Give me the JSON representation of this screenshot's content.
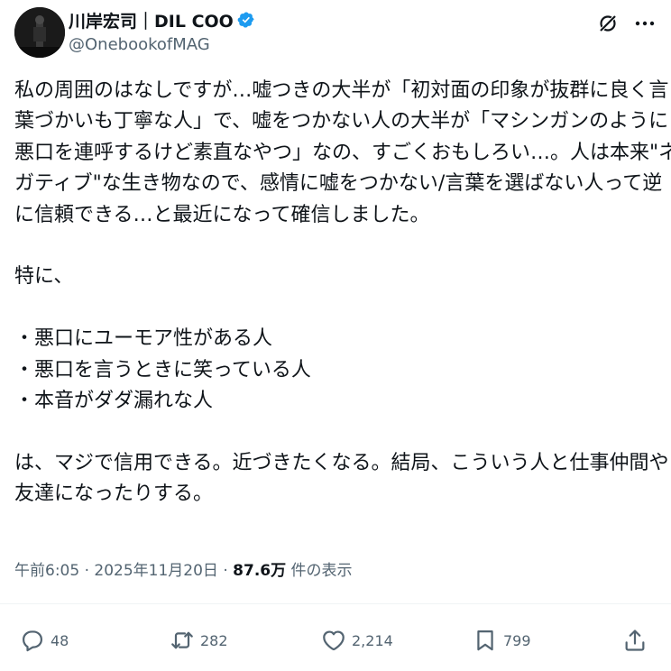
{
  "author": {
    "display_name": "川岸宏司｜DIL COO",
    "handle": "@OnebookofMAG",
    "verified": true,
    "verified_color": "#1d9bf0"
  },
  "post": {
    "lines": [
      "私の周囲のはなしですが…嘘つきの大半が「初対面の印象が抜群に良く言",
      "葉づかいも丁寧な人」で、嘘をつかない人の大半が「マシンガンのように",
      "悪口を連呼するけど素直なやつ」なの、すごくおもしろい…。人は本来\"ネ",
      "ガティブ\"な生き物なので、感情に嘘をつかない/言葉を選ばない人って逆",
      "に信頼できる…と最近になって確信しました。",
      "",
      "特に、",
      "",
      "・悪口にユーモア性がある人",
      "・悪口を言うときに笑っている人",
      "・本音がダダ漏れな人",
      "",
      "は、マジで信用できる。近づきたくなる。結局、こういう人と仕事仲間や",
      "友達になったりする。"
    ]
  },
  "meta": {
    "time": "午前6:05",
    "separator": "·",
    "date": "2025年11月20日",
    "views_count": "87.6万",
    "views_label": "件の表示"
  },
  "actions": {
    "replies": "48",
    "reposts": "282",
    "likes": "2,214",
    "bookmarks": "799"
  },
  "icons": {
    "header_right": [
      "grok-icon",
      "more-icon"
    ],
    "action_bar": [
      "reply-icon",
      "repost-icon",
      "like-icon",
      "bookmark-icon",
      "share-icon"
    ]
  },
  "colors": {
    "text": "#0f1419",
    "secondary": "#536471",
    "divider": "#eff3f4"
  }
}
